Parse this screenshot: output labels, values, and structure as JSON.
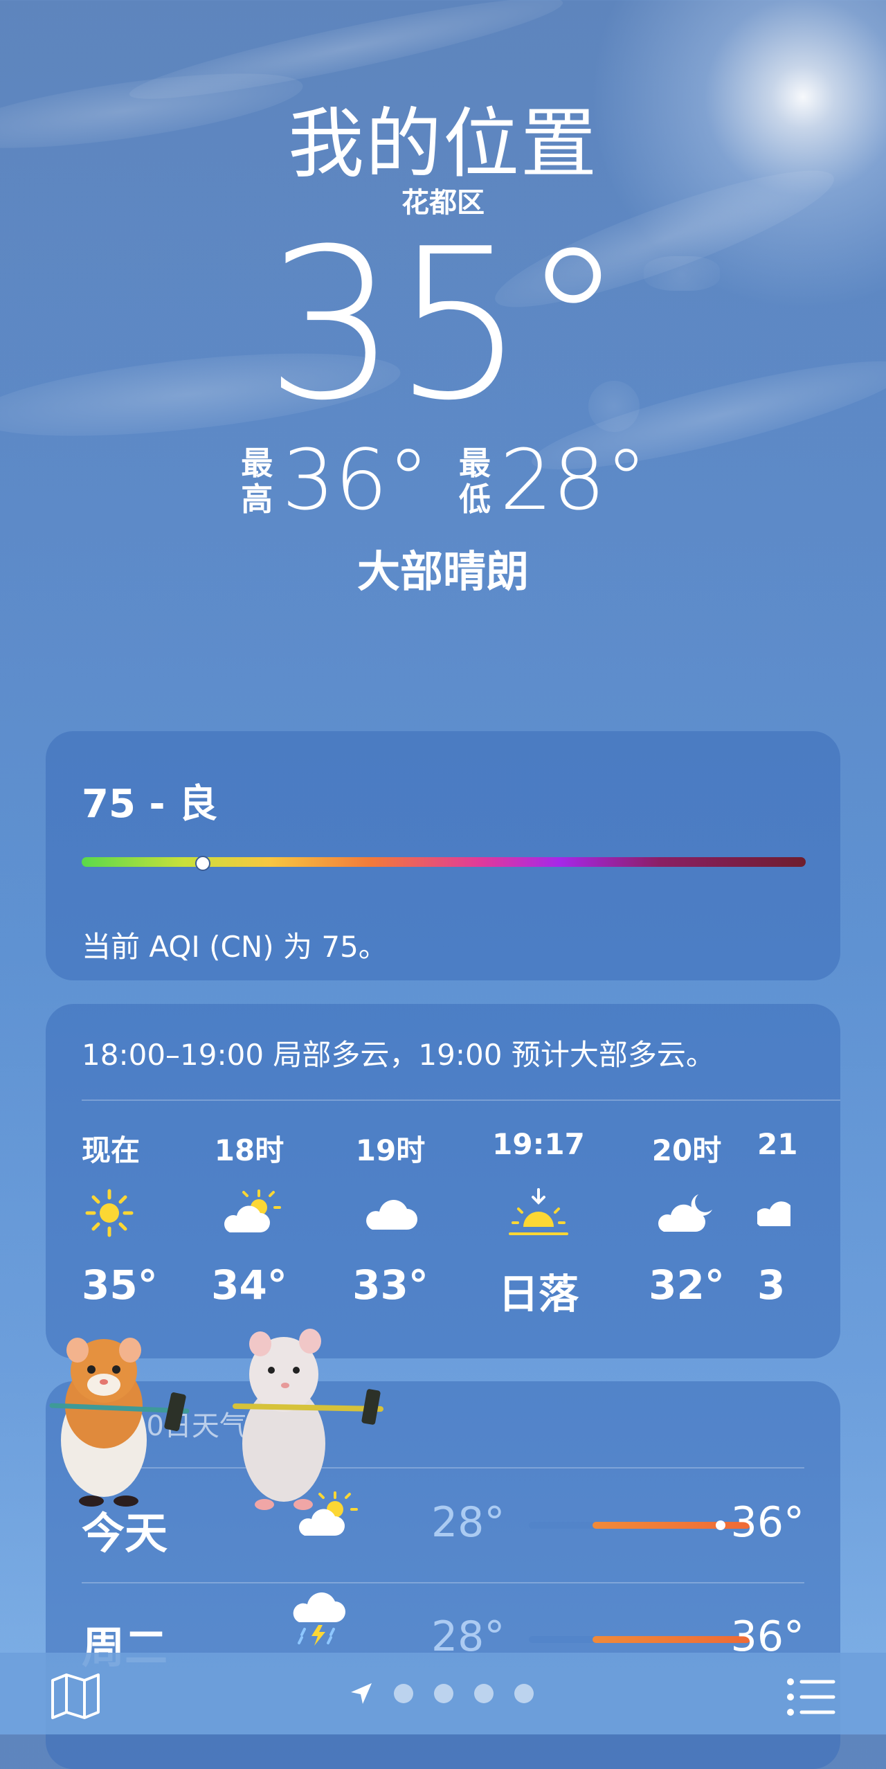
{
  "location": {
    "title": "我的位置",
    "district": "花都区",
    "temperature": "35°",
    "high_label": "最高",
    "high": "36°",
    "low_label": "最低",
    "low": "28°",
    "condition": "大部晴朗"
  },
  "aqi": {
    "headline": "75 - 良",
    "value": 75,
    "description": "当前 AQI (CN) 为 75。"
  },
  "hourly": {
    "summary": "18:00–19:00 局部多云，19:00 预计大部多云。",
    "items": [
      {
        "label": "现在",
        "icon": "sun-icon",
        "temp": "35°"
      },
      {
        "label": "18时",
        "icon": "partly-cloudy-icon",
        "temp": "34°"
      },
      {
        "label": "19时",
        "icon": "cloud-icon",
        "temp": "33°"
      },
      {
        "label": "19:17",
        "icon": "sunset-icon",
        "temp": "日落"
      },
      {
        "label": "20时",
        "icon": "cloudy-night-icon",
        "temp": "32°"
      },
      {
        "label": "21",
        "icon": "cloud-icon",
        "temp": "3"
      }
    ]
  },
  "daily": {
    "header": "10日天气",
    "rows": [
      {
        "day": "今天",
        "icon": "partly-cloudy-icon",
        "low": "28°",
        "high": "36°"
      },
      {
        "day": "周二",
        "icon": "thunderstorm-icon",
        "low": "28°",
        "high": "36°"
      }
    ]
  },
  "bottom_bar": {
    "map_icon": "map-icon",
    "location_icon": "location-arrow-icon",
    "page_dots": 4,
    "list_icon": "list-icon"
  }
}
